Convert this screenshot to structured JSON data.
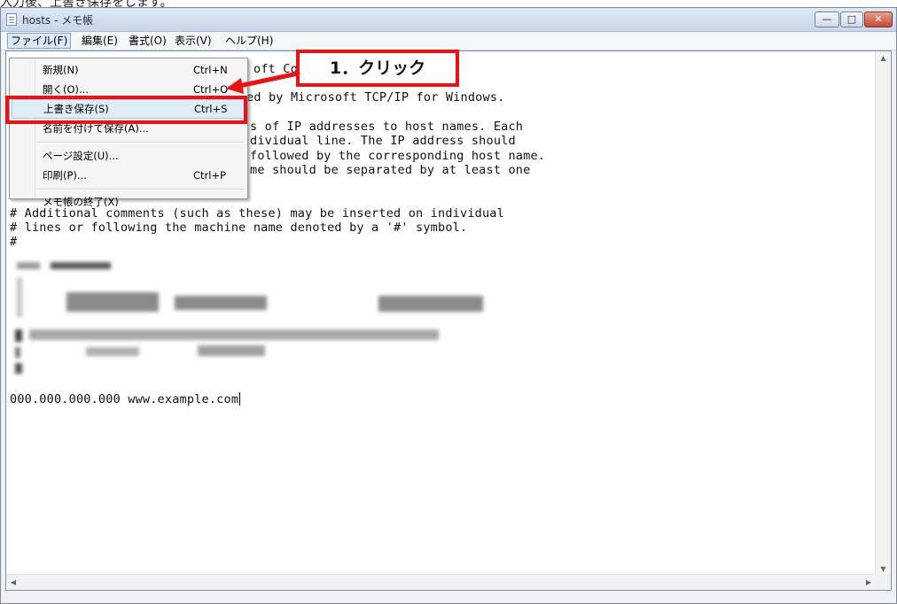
{
  "caption": "入力後、上書き保存をします。",
  "window": {
    "title": "hosts - メモ帳"
  },
  "menubar": [
    "ファイル(F)",
    "編集(E)",
    "書式(O)",
    "表示(V)",
    "ヘルプ(H)"
  ],
  "file_menu": {
    "items": [
      {
        "label": "新規(N)",
        "shortcut": "Ctrl+N"
      },
      {
        "label": "開く(O)...",
        "shortcut": "Ctrl+O"
      },
      {
        "label": "上書き保存(S)",
        "shortcut": "Ctrl+S",
        "highlighted": true
      },
      {
        "label": "名前を付けて保存(A)...",
        "shortcut": ""
      },
      {
        "label": "ページ設定(U)...",
        "shortcut": ""
      },
      {
        "label": "印刷(P)...",
        "shortcut": "Ctrl+P"
      },
      {
        "label": "メモ帳の終了(X)",
        "shortcut": ""
      }
    ]
  },
  "annotation": {
    "callout_text": "1．クリック",
    "color": "#ee1111"
  },
  "editor": {
    "visible_fragments": {
      "l1": "oft Co",
      "l2": "ed by Microsoft TCP/IP for Windows.",
      "l3": "s of IP addresses to host names. Each",
      "l4": "dividual line. The IP address should",
      "l5": "followed by the corresponding host name.",
      "l6": "me should be separated by at least one"
    },
    "lines_after_menu": [
      "# Additional comments (such as these) may be inserted on individual",
      "# lines or following the machine name denoted by a '#' symbol.",
      "#"
    ],
    "added_entry": "000.000.000.000 www.example.com"
  }
}
